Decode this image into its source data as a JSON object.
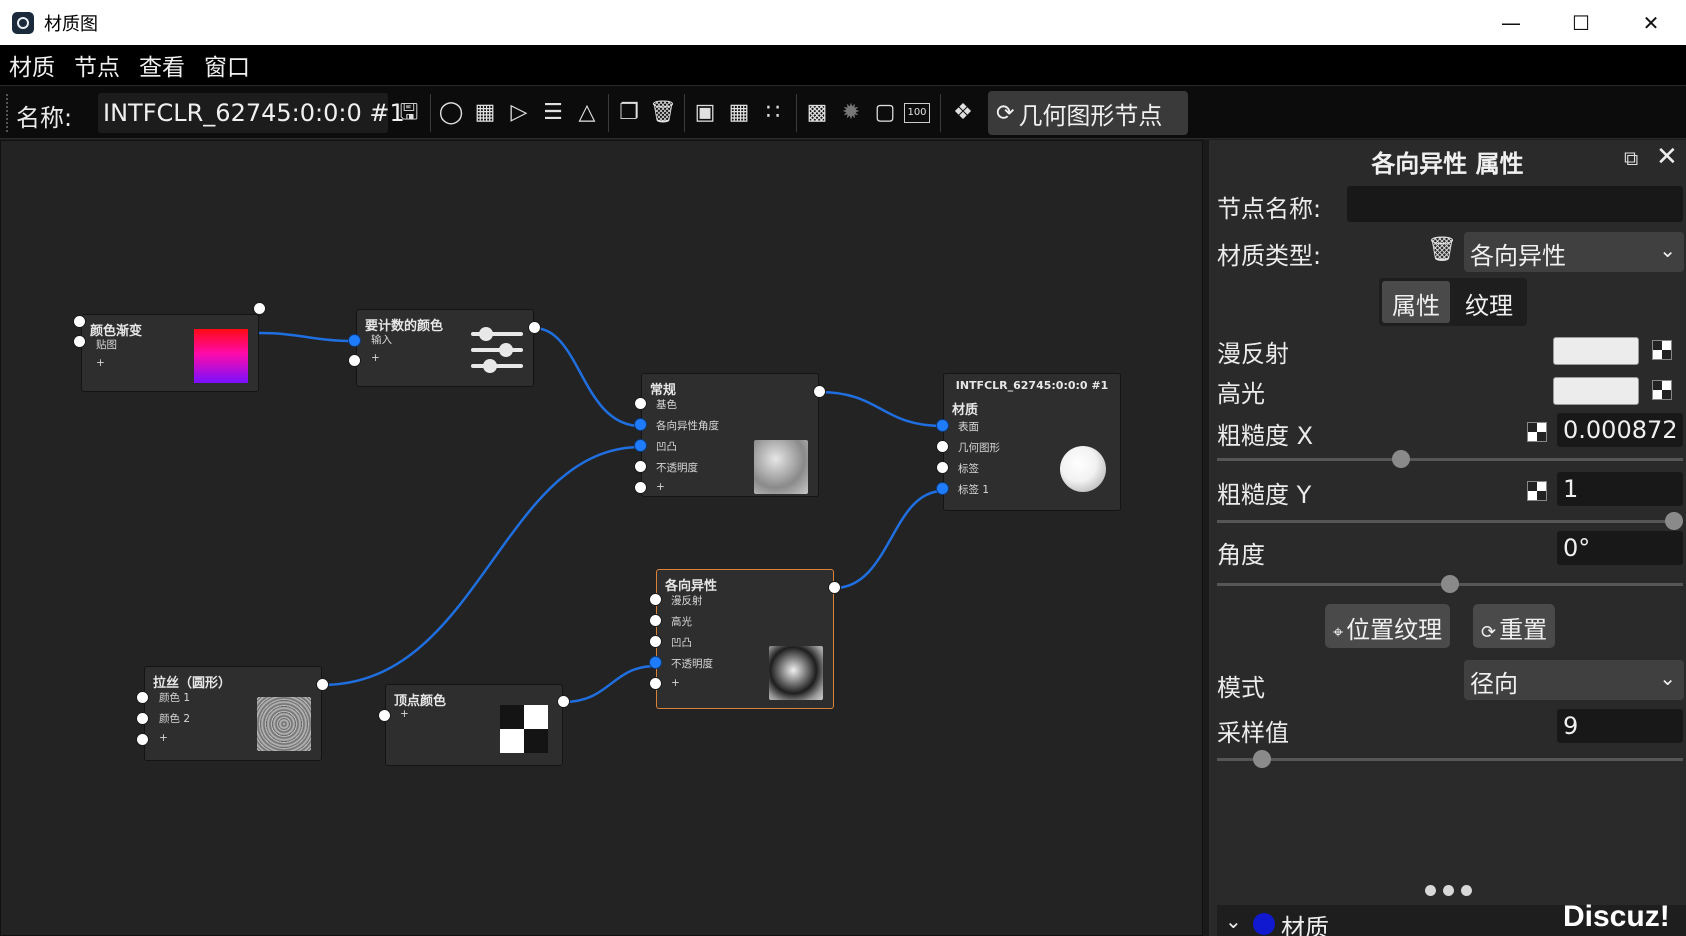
{
  "window": {
    "title": "材质图",
    "minimize": "—",
    "maximize": "☐",
    "close": "✕"
  },
  "menu": [
    "材质",
    "节点",
    "查看",
    "窗口"
  ],
  "toolbar": {
    "name_label": "名称:",
    "name_value": "INTFCLR_62745:0:0:0 #1",
    "geometry_button": "几何图形节点",
    "geometry_icon": "refresh-icon",
    "icons": [
      "save-icon",
      "sphere-preview-icon",
      "checker-preview-icon",
      "play-icon",
      "sliders-icon",
      "flask-icon",
      "copy-icon",
      "delete-icon",
      "material-icon",
      "grid-icon",
      "scatter-icon",
      "layout-icon",
      "network-icon",
      "frame-icon",
      "100-icon",
      "share-icon"
    ],
    "zoom_label": "100"
  },
  "nodes": {
    "gradient": {
      "title": "颜色渐变",
      "ports": [
        "贴图",
        "+"
      ]
    },
    "count_color": {
      "title": "要计数的颜色",
      "ports": [
        "输入",
        "+"
      ]
    },
    "normal": {
      "title": "常规",
      "ports": [
        "基色",
        "各向异性角度",
        "凹凸",
        "不透明度",
        "+"
      ]
    },
    "output": {
      "title": "INTFCLR_62745:0:0:0 #1",
      "subtitle": "材质",
      "ports": [
        "表面",
        "几何图形",
        "标签",
        "标签 1"
      ]
    },
    "anisotropic": {
      "title": "各向异性",
      "ports": [
        "漫反射",
        "高光",
        "凹凸",
        "不透明度",
        "+"
      ]
    },
    "brushed": {
      "title": "拉丝（圆形）",
      "ports": [
        "颜色 1",
        "颜色 2",
        "+"
      ]
    },
    "vertex_color": {
      "title": "顶点颜色",
      "ports": [
        "+"
      ]
    }
  },
  "properties": {
    "title": "各向异性 属性",
    "node_name_label": "节点名称:",
    "node_name_value": "",
    "material_type_label": "材质类型:",
    "material_type_value": "各向异性",
    "tabs": [
      "属性",
      "纹理"
    ],
    "diffuse_label": "漫反射",
    "specular_label": "高光",
    "roughness_x_label": "粗糙度 X",
    "roughness_x_value": "0.000872",
    "roughness_x_level": 0.39,
    "roughness_y_label": "粗糙度 Y",
    "roughness_y_value": "1",
    "roughness_y_level": 1.0,
    "angle_label": "角度",
    "angle_value": "0°",
    "angle_level": 0.5,
    "position_texture_button": "位置纹理",
    "reset_button": "重置",
    "mode_label": "模式",
    "mode_value": "径向",
    "samples_label": "采样值",
    "samples_value": "9",
    "samples_level": 0.08,
    "section_label": "材质"
  },
  "watermark": "Discuz!",
  "colors": {
    "wire": "#1f6fe0",
    "port_blue": "#1f7cff",
    "selected_border": "#d8823a",
    "material_dot": "#1018d0"
  }
}
